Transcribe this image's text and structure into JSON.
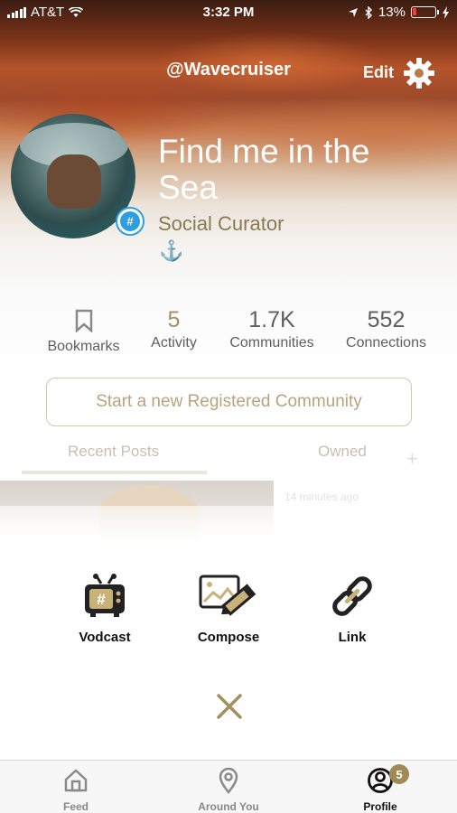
{
  "status": {
    "carrier": "AT&T",
    "time": "3:32 PM",
    "battery": "13%"
  },
  "profile": {
    "username": "@Wavecruiser",
    "edit_label": "Edit",
    "bio_title": "Find me in the Sea",
    "role": "Social Curator",
    "anchor": "⚓"
  },
  "stats": [
    {
      "value": "",
      "label": "Bookmarks"
    },
    {
      "value": "5",
      "label": "Activity"
    },
    {
      "value": "1.7K",
      "label": "Communities"
    },
    {
      "value": "552",
      "label": "Connections"
    }
  ],
  "cta_label": "Start a new Registered Community",
  "tabs": {
    "recent": "Recent Posts",
    "owned": "Owned",
    "add": "+"
  },
  "post": {
    "time": "14 minutes ago"
  },
  "actions": {
    "vodcast": "Vodcast",
    "compose": "Compose",
    "link": "Link"
  },
  "tabbar": {
    "feed": "Feed",
    "around": "Around You",
    "profile": "Profile",
    "profile_count": "5"
  },
  "colors": {
    "accent_gold": "#a58f5e",
    "cta_border": "#d6c8a8",
    "badge_blue": "#2c9fe0"
  }
}
